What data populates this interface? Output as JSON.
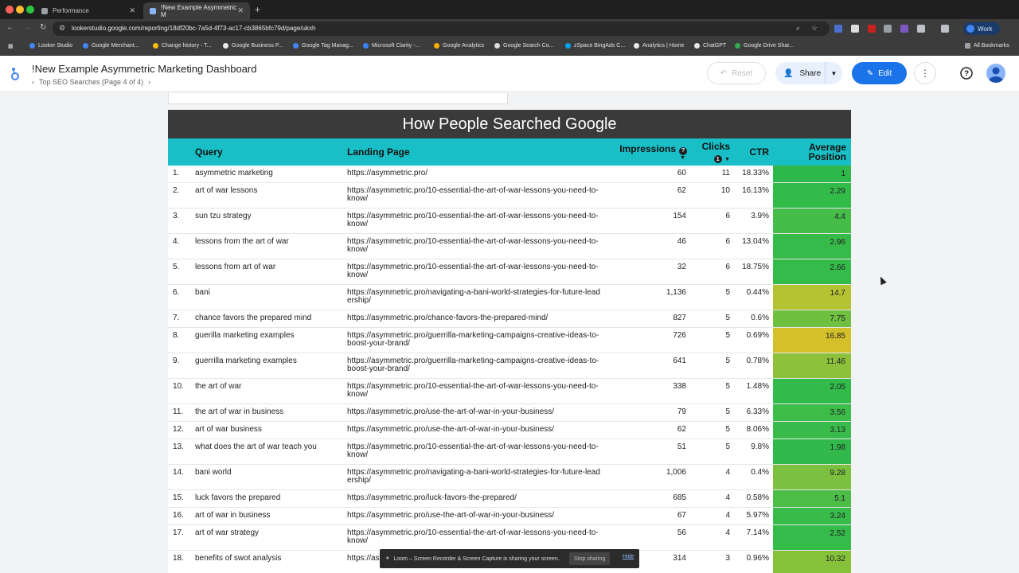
{
  "browser": {
    "tabs": [
      {
        "label": "Performance",
        "active": false
      },
      {
        "label": "!New Example Asymmetric M",
        "active": true
      }
    ],
    "url": "lookerstudio.google.com/reporting/18df20bc-7a5d-4f73-ac17-cb3865bfc79d/page/ukxh",
    "profile": "Work",
    "bookmarks": [
      "Looker Studio",
      "Google Merchant...",
      "Change history - T...",
      "Google Business P...",
      "Google Tag Manag...",
      "Microsoft Clarity -...",
      "Google Analytics",
      "Google Search Co...",
      "zSpace BingAds C...",
      "Analytics | Home",
      "ChatGPT",
      "Google Drive Shar..."
    ],
    "all_bookmarks": "All Bookmarks",
    "ext_badges": [
      "14",
      "20"
    ]
  },
  "header": {
    "title": "!New Example Asymmetric Marketing Dashboard",
    "page_nav": "Top SEO Searches (Page 4 of 4)",
    "reset": "Reset",
    "share": "Share",
    "edit": "Edit"
  },
  "report": {
    "title": "How People Searched Google",
    "columns": {
      "query": "Query",
      "landing_page": "Landing Page",
      "impressions": "Impressions",
      "clicks": "Clicks",
      "ctr": "CTR",
      "avg_position": "Average Position"
    },
    "hint_impressions": "?",
    "hint_clicks": "1",
    "rows": [
      {
        "idx": "1.",
        "query": "asymmetric marketing",
        "url": "https://asymmetric.pro/",
        "impressions": "60",
        "clicks": "11",
        "ctr": "18.33%",
        "position": "1",
        "color": "#2db84b"
      },
      {
        "idx": "2.",
        "query": "art of war lessons",
        "url": "https://asymmetric.pro/10-essential-the-art-of-war-lessons-you-need-to-know/",
        "impressions": "62",
        "clicks": "10",
        "ctr": "16.13%",
        "position": "2.29",
        "color": "#33bb4a"
      },
      {
        "idx": "3.",
        "query": "sun tzu strategy",
        "url": "https://asymmetric.pro/10-essential-the-art-of-war-lessons-you-need-to-know/",
        "impressions": "154",
        "clicks": "6",
        "ctr": "3.9%",
        "position": "4.4",
        "color": "#45bd48"
      },
      {
        "idx": "4.",
        "query": "lessons from the art of war",
        "url": "https://asymmetric.pro/10-essential-the-art-of-war-lessons-you-need-to-know/",
        "impressions": "46",
        "clicks": "6",
        "ctr": "13.04%",
        "position": "2.96",
        "color": "#36bb4a"
      },
      {
        "idx": "5.",
        "query": "lessons from art of war",
        "url": "https://asymmetric.pro/10-essential-the-art-of-war-lessons-you-need-to-know/",
        "impressions": "32",
        "clicks": "6",
        "ctr": "18.75%",
        "position": "2.66",
        "color": "#35bb4a"
      },
      {
        "idx": "6.",
        "query": "bani",
        "url": "https://asymmetric.pro/navigating-a-bani-world-strategies-for-future-leadership/",
        "impressions": "1,136",
        "clicks": "5",
        "ctr": "0.44%",
        "position": "14.7",
        "color": "#b5c232"
      },
      {
        "idx": "7.",
        "query": "chance favors the prepared mind",
        "url": "https://asymmetric.pro/chance-favors-the-prepared-mind/",
        "impressions": "827",
        "clicks": "5",
        "ctr": "0.6%",
        "position": "7.75",
        "color": "#6fbf40"
      },
      {
        "idx": "8.",
        "query": "guerilla marketing examples",
        "url": "https://asymmetric.pro/guerrilla-marketing-campaigns-creative-ideas-to-boost-your-brand/",
        "impressions": "726",
        "clicks": "5",
        "ctr": "0.69%",
        "position": "16.85",
        "color": "#d4c12a"
      },
      {
        "idx": "9.",
        "query": "guerrilla marketing examples",
        "url": "https://asymmetric.pro/guerrilla-marketing-campaigns-creative-ideas-to-boost-your-brand/",
        "impressions": "641",
        "clicks": "5",
        "ctr": "0.78%",
        "position": "11.46",
        "color": "#8ec13b"
      },
      {
        "idx": "10.",
        "query": "the art of war",
        "url": "https://asymmetric.pro/10-essential-the-art-of-war-lessons-you-need-to-know/",
        "impressions": "338",
        "clicks": "5",
        "ctr": "1.48%",
        "position": "2.05",
        "color": "#32ba4a"
      },
      {
        "idx": "11.",
        "query": "the art of war in business",
        "url": "https://asymmetric.pro/use-the-art-of-war-in-your-business/",
        "impressions": "79",
        "clicks": "5",
        "ctr": "6.33%",
        "position": "3.56",
        "color": "#3cbc49"
      },
      {
        "idx": "12.",
        "query": "art of war business",
        "url": "https://asymmetric.pro/use-the-art-of-war-in-your-business/",
        "impressions": "62",
        "clicks": "5",
        "ctr": "8.06%",
        "position": "3.13",
        "color": "#38bb4a"
      },
      {
        "idx": "13.",
        "query": "what does the art of war teach you",
        "url": "https://asymmetric.pro/10-essential-the-art-of-war-lessons-you-need-to-know/",
        "impressions": "51",
        "clicks": "5",
        "ctr": "9.8%",
        "position": "1.98",
        "color": "#31ba4b"
      },
      {
        "idx": "14.",
        "query": "bani world",
        "url": "https://asymmetric.pro/navigating-a-bani-world-strategies-for-future-leadership/",
        "impressions": "1,006",
        "clicks": "4",
        "ctr": "0.4%",
        "position": "9.28",
        "color": "#7bc03e"
      },
      {
        "idx": "15.",
        "query": "luck favors the prepared",
        "url": "https://asymmetric.pro/luck-favors-the-prepared/",
        "impressions": "685",
        "clicks": "4",
        "ctr": "0.58%",
        "position": "5.1",
        "color": "#4cbd47"
      },
      {
        "idx": "16.",
        "query": "art of war in business",
        "url": "https://asymmetric.pro/use-the-art-of-war-in-your-business/",
        "impressions": "67",
        "clicks": "4",
        "ctr": "5.97%",
        "position": "3.24",
        "color": "#39bb4a"
      },
      {
        "idx": "17.",
        "query": "art of war strategy",
        "url": "https://asymmetric.pro/10-essential-the-art-of-war-lessons-you-need-to-know/",
        "impressions": "56",
        "clicks": "4",
        "ctr": "7.14%",
        "position": "2.52",
        "color": "#34bb4a"
      },
      {
        "idx": "18.",
        "query": "benefits of swot analysis",
        "url": "https://asymmetric.pro/business-success/",
        "impressions": "314",
        "clicks": "3",
        "ctr": "0.96%",
        "position": "10.32",
        "color": "#86c13c"
      }
    ]
  },
  "loom": {
    "message": "Loom – Screen Recorder & Screen Capture is sharing your screen.",
    "stop": "Stop sharing",
    "hide": "Hide"
  }
}
